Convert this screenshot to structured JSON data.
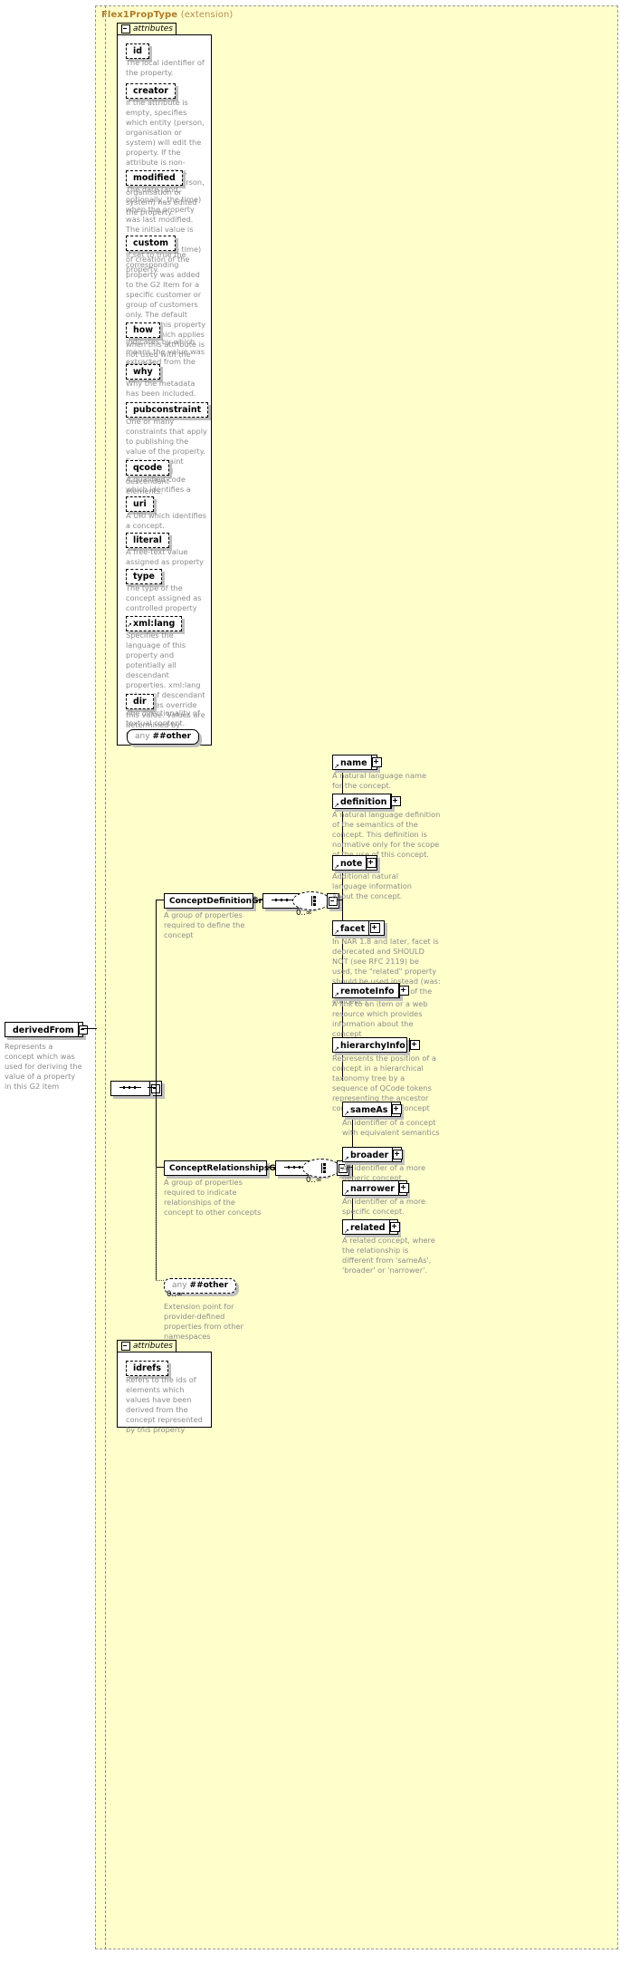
{
  "diagram": {
    "type_title": "Flex1PropType",
    "type_title_suffix": "(extension)",
    "attributes_label": "attributes",
    "attributes_label_2": "attributes",
    "root_element": {
      "name": "derivedFrom",
      "desc": "Represents a concept which was used for deriving the value of a property in this G2 item"
    },
    "cardinality_any": "0..∞",
    "cardinality_cdg": "0..∞",
    "cardinality_crg": "0..∞"
  },
  "attributes": [
    {
      "name": "id",
      "desc": "The local identifier of the property."
    },
    {
      "name": "creator",
      "desc": "If the attribute is empty, specifies which entity (person, organisation or system) will edit the property. If the attribute is non-empty, specifies which entity (person, organisation or system) has edited the property."
    },
    {
      "name": "modified",
      "desc": "The date (and, optionally, the time) when the property was last modified. The initial value is the date (and, optionally, the time) of creation of the property."
    },
    {
      "name": "custom",
      "desc": "If set to true the corresponding property was added to the G2 Item for a specific customer or group of customers only. The default value of this property is false which applies when this attribute is not used with the property."
    },
    {
      "name": "how",
      "desc": "Indicates by which means the value was extracted from the content."
    },
    {
      "name": "why",
      "desc": "Why the metadata has been included."
    },
    {
      "name": "pubconstraint",
      "desc": "One or many constraints that apply to publishing the value of the property. Each constraint applies to all descendant elements."
    },
    {
      "name": "qcode",
      "desc": "A qualified code which identifies a concept."
    },
    {
      "name": "uri",
      "desc": "A URI which identifies a concept."
    },
    {
      "name": "literal",
      "desc": "A free-text value assigned as property value."
    },
    {
      "name": "type",
      "desc": "The type of the concept assigned as controlled property value."
    },
    {
      "name": "xml:lang",
      "desc": "Specifies the language of this property and potentially all descendant properties. xml:lang values of descendant properties override this value. Values are determined by Internet BCP 47."
    },
    {
      "name": "dir",
      "desc": "The directionality of textual content."
    }
  ],
  "any_attribute": {
    "prefix": "any",
    "name": "##other"
  },
  "groups": [
    {
      "name": "ConceptDefinitionGroup",
      "desc": "A group of properties required to define the concept",
      "children": [
        {
          "name": "name",
          "desc": "A natural language name for the concept."
        },
        {
          "name": "definition",
          "desc": "A natural language definition of the semantics of the concept. This definition is normative only for the scope of the use of this concept."
        },
        {
          "name": "note",
          "desc": "Additional natural language information about the concept."
        },
        {
          "name": "facet",
          "desc": "In NAR 1.8 and later, facet is deprecated and SHOULD NOT (see RFC 2119) be used, the \"related\" property should be used instead (was: An intrinsic property of the concept.)"
        },
        {
          "name": "remoteInfo",
          "desc": "A link to an item or a web resource which provides information about the concept"
        },
        {
          "name": "hierarchyInfo",
          "desc": "Represents the position of a concept in a hierarchical taxonomy tree by a sequence of QCode tokens representing the ancestor concepts and this concept"
        }
      ]
    },
    {
      "name": "ConceptRelationshipsGroup",
      "desc": "A group of properties required to indicate relationships of the concept to other concepts",
      "children": [
        {
          "name": "sameAs",
          "desc": "An identifier of a concept with equivalent semantics"
        },
        {
          "name": "broader",
          "desc": "An identifier of a more generic concept."
        },
        {
          "name": "narrower",
          "desc": "An identifier of a more specific concept."
        },
        {
          "name": "related",
          "desc": "A related concept, where the relationship is different from 'sameAs', 'broader' or 'narrower'."
        }
      ]
    }
  ],
  "any_element": {
    "prefix": "any",
    "name": "##other",
    "cardinality": "0..∞",
    "desc": "Extension point for provider-defined properties from other namespaces"
  },
  "idrefs": {
    "name": "idrefs",
    "desc": "Refers to the ids of elements which values have been derived from the concept represented by this property"
  },
  "colors": {
    "background_yellow": "#ffffcc",
    "text_gray": "#8c8c8c",
    "title_brown": "#b07a2a",
    "shadow": "#bfbfbf"
  }
}
